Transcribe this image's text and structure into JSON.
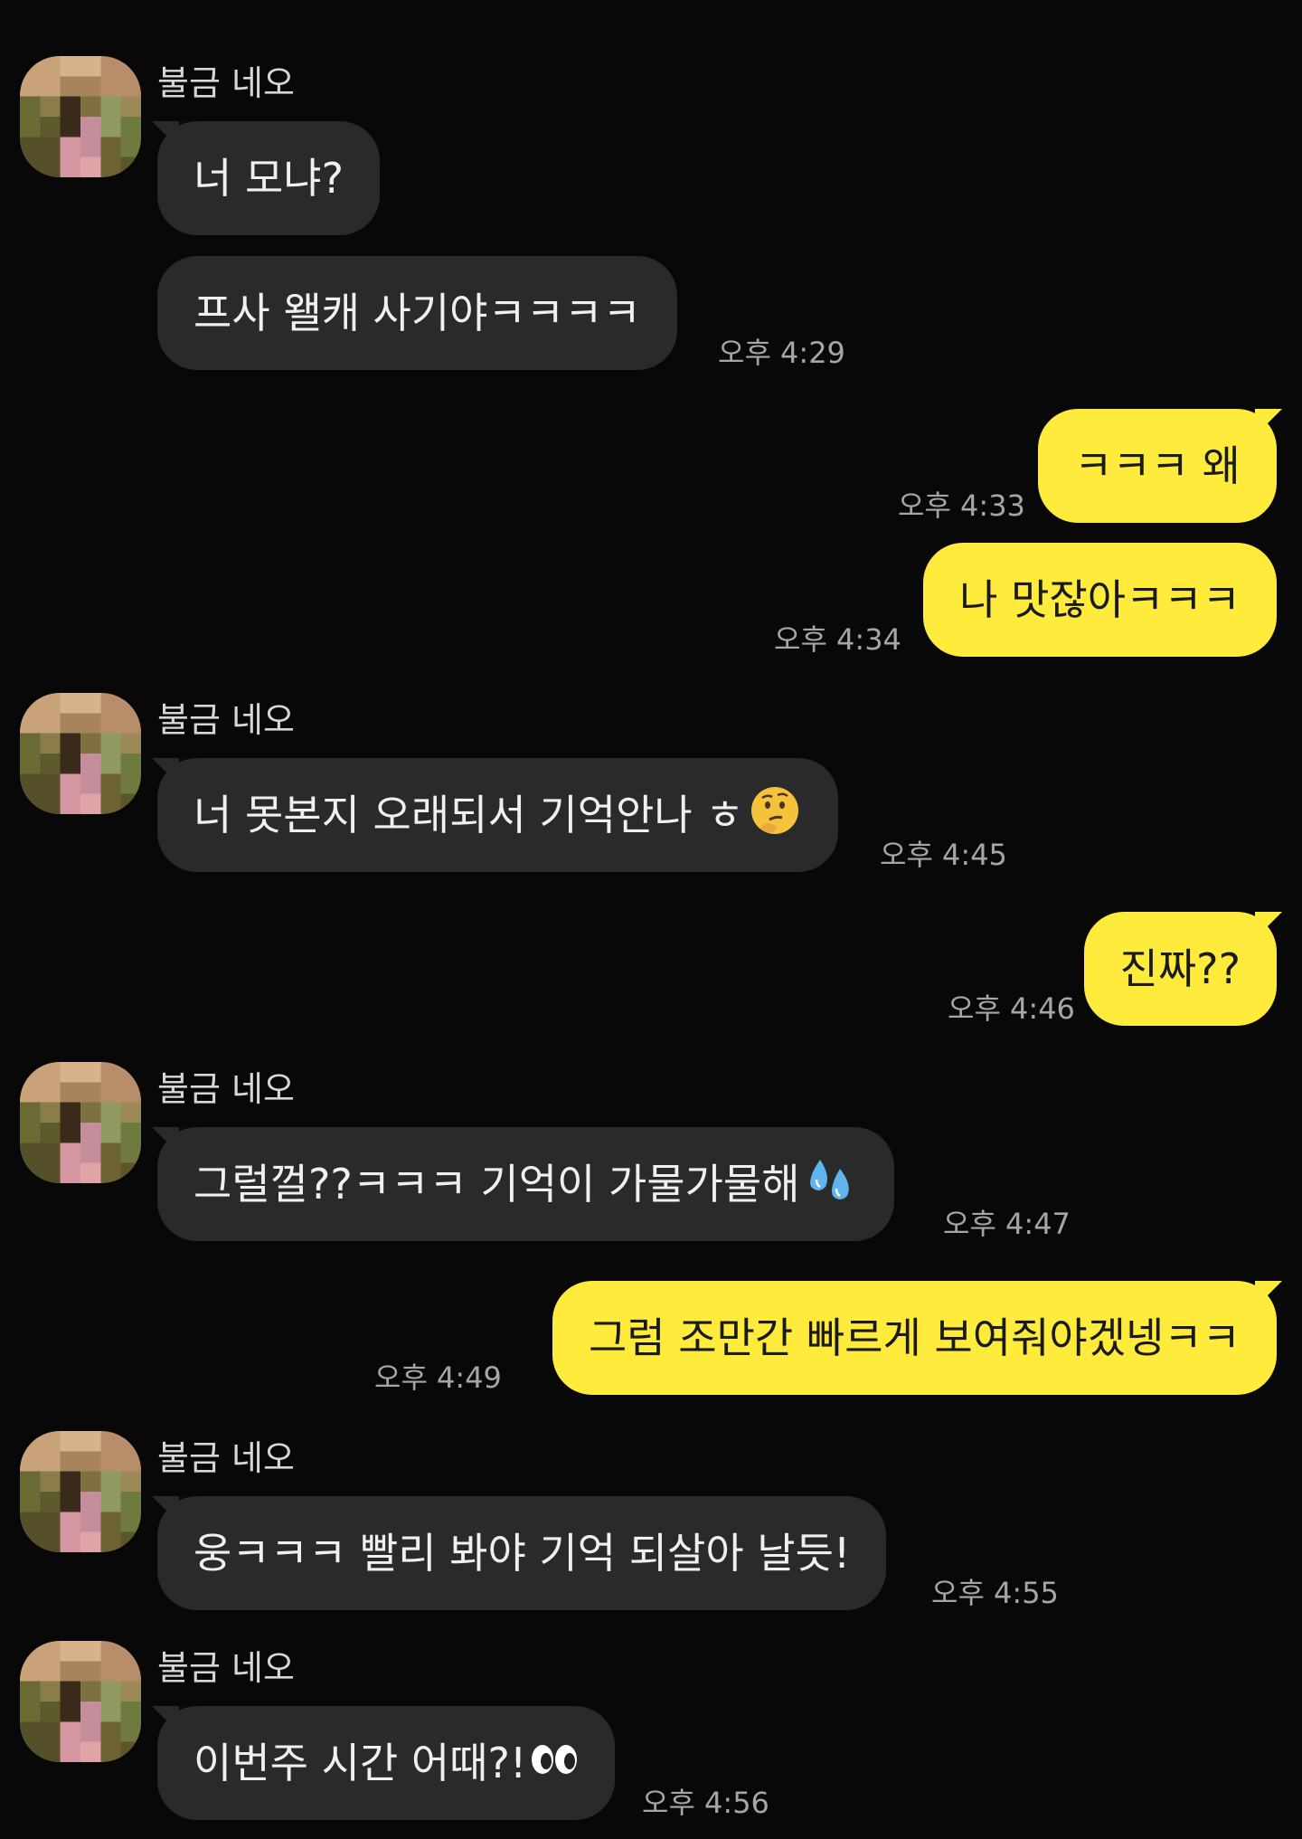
{
  "sender_name": "불금 네오",
  "messages": [
    {
      "text": "너 모냐?"
    },
    {
      "text": "프사 왤캐 사기야ㅋㅋㅋㅋ",
      "time": "오후 4:29"
    },
    {
      "text": "ㅋㅋㅋ 왜",
      "time": "오후 4:33"
    },
    {
      "text": "나 맛잖아ㅋㅋㅋ",
      "time": "오후 4:34"
    },
    {
      "text": "너 못본지 오래되서 기억안나 ㅎ",
      "emoji": "thinking-face",
      "time": "오후 4:45"
    },
    {
      "text": "진짜??",
      "time": "오후 4:46"
    },
    {
      "text": "그럴껄??ㅋㅋㅋ 기억이 가물가물해",
      "emoji": "sweat-droplets",
      "time": "오후 4:47"
    },
    {
      "text": "그럼 조만간 빠르게 보여줘야겠넹ㅋㅋ",
      "time": "오후 4:49"
    },
    {
      "text": "웅ㅋㅋㅋ 빨리 봐야 기억 되살아 날듯!",
      "time": "오후 4:55"
    },
    {
      "text": "이번주 시간 어때?!",
      "emoji": "eyes",
      "time": "오후 4:56"
    }
  ],
  "colors": {
    "background": "#080808",
    "incoming_bubble": "#2a2a2a",
    "outgoing_bubble": "#ffeb3b"
  }
}
